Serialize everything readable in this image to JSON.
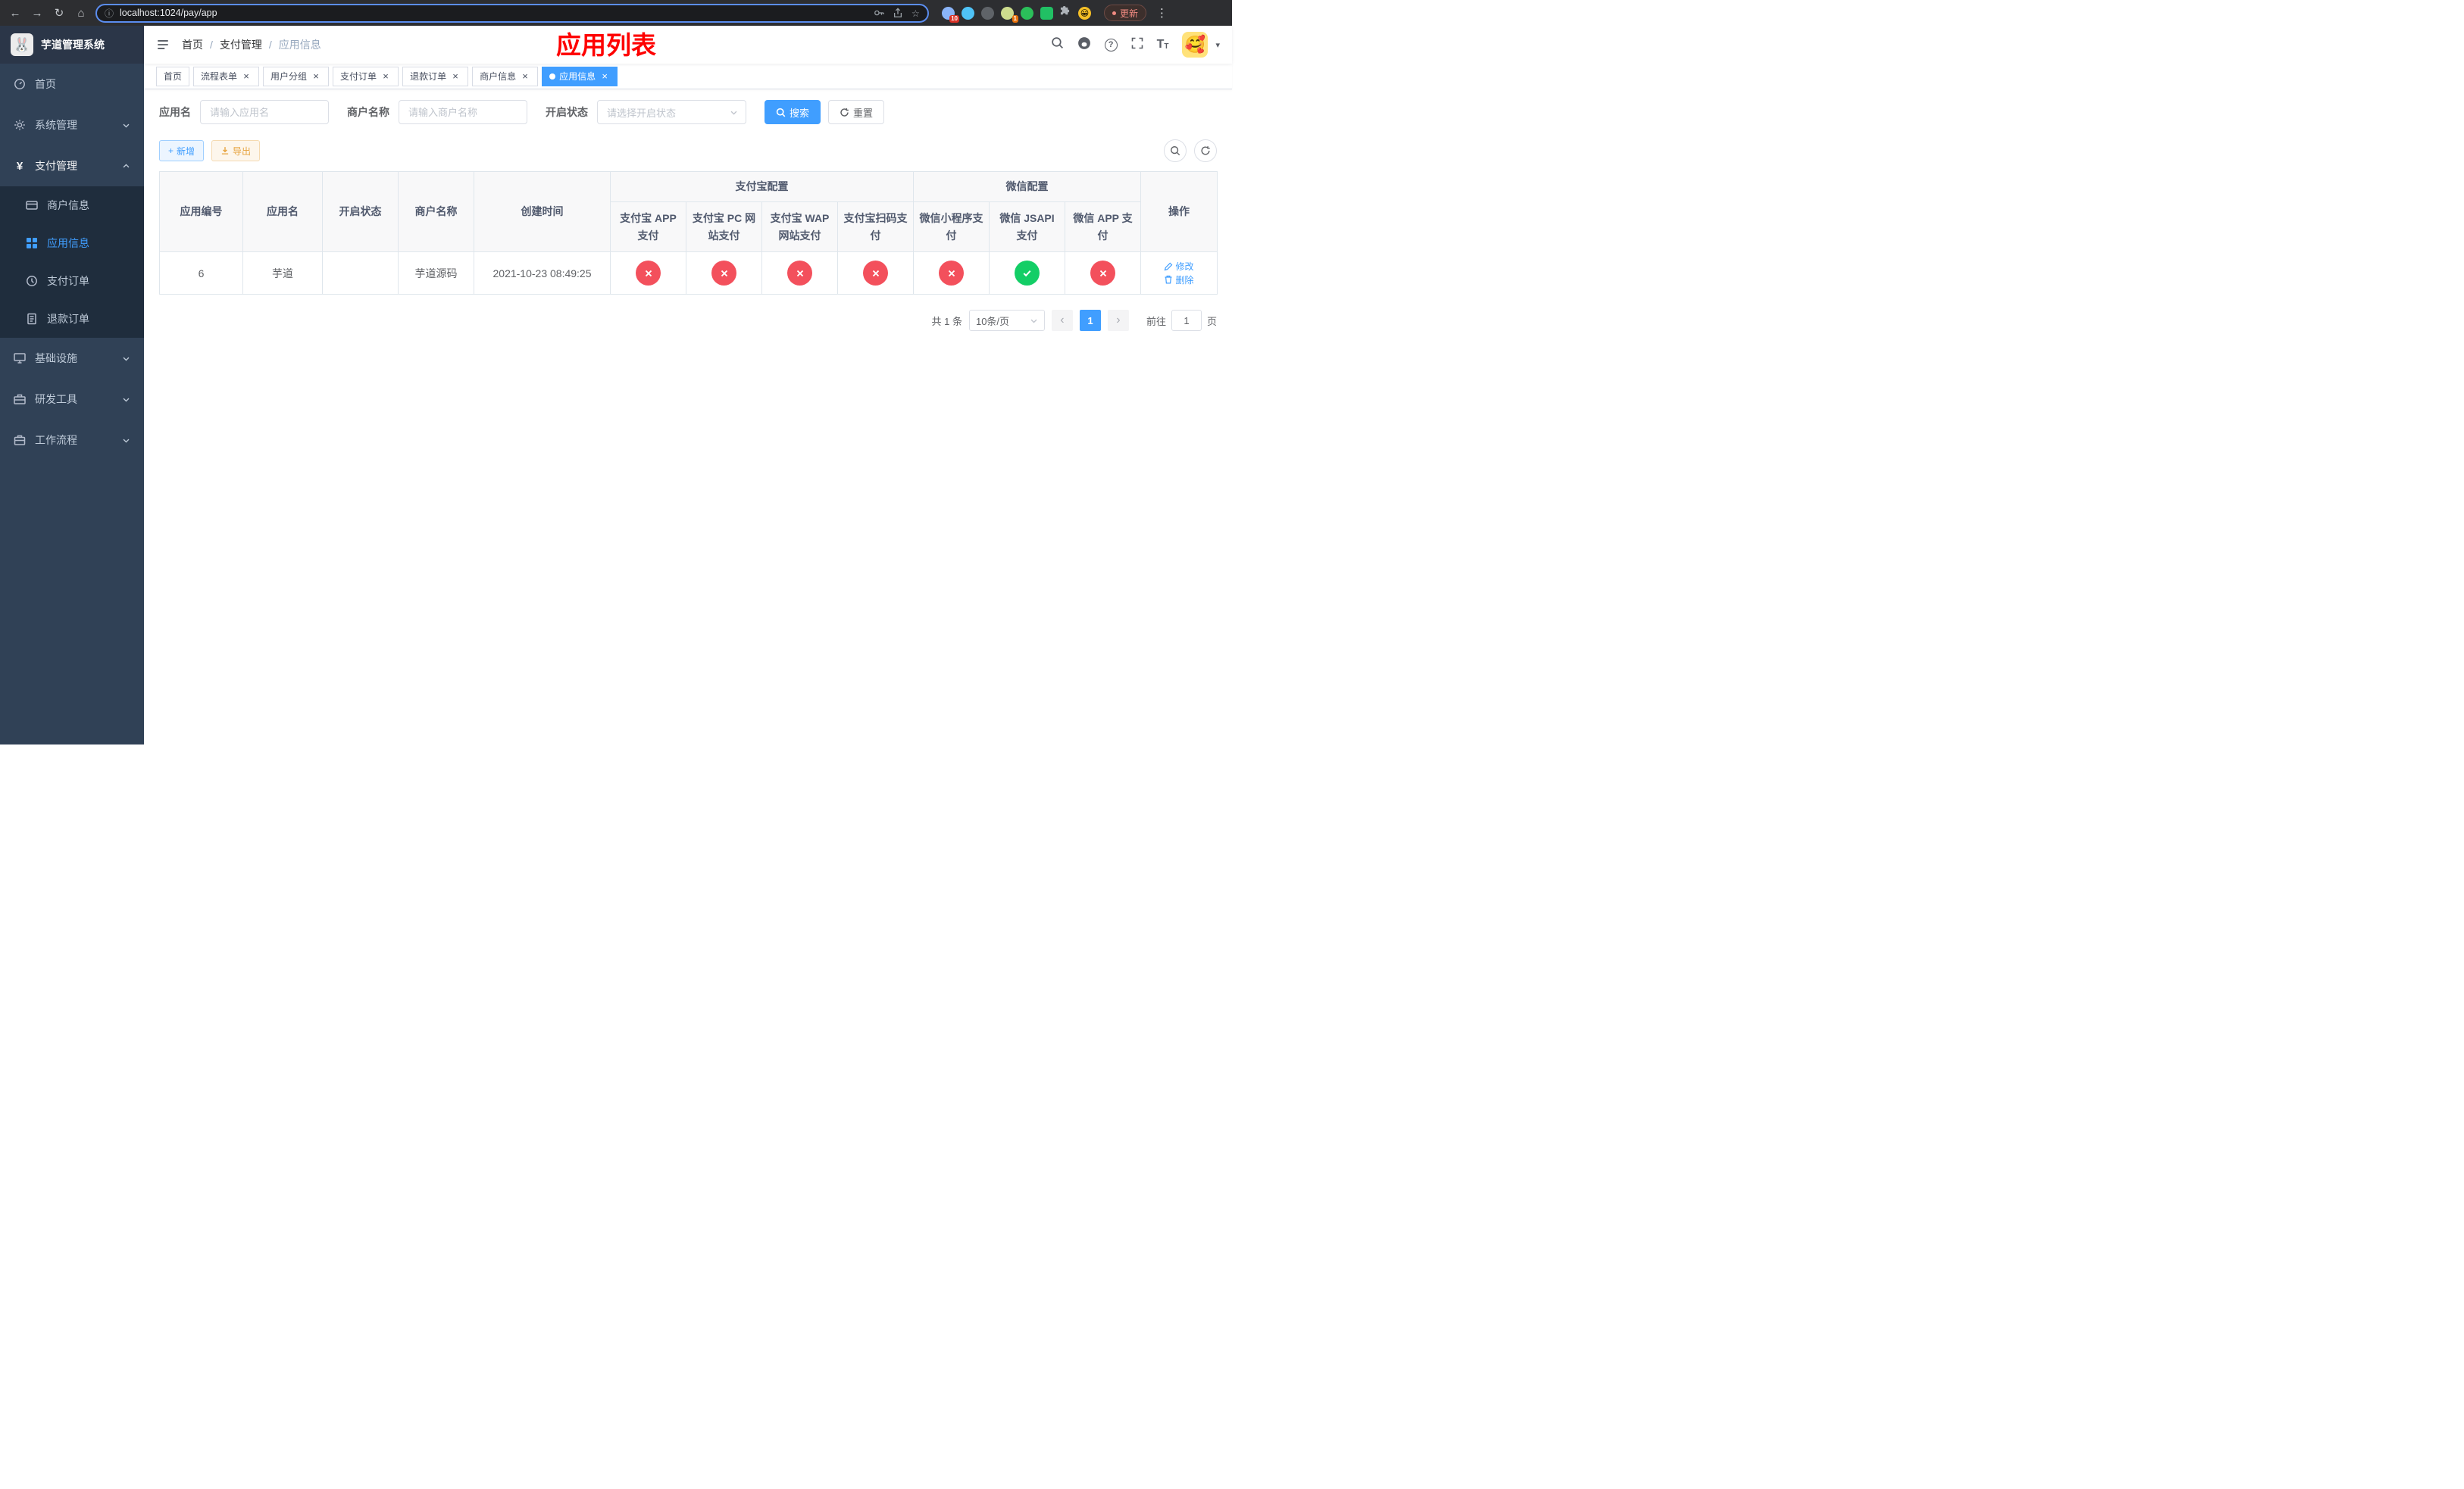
{
  "icons": {
    "back": "←",
    "forward": "→",
    "reload": "↻",
    "home": "⌂",
    "info": "ⓘ",
    "star": "☆",
    "menu_dots": "⋮",
    "caret_down": "▾",
    "close": "×",
    "plus": "+",
    "help": "?",
    "yen": "¥",
    "font_size": "T",
    "prev": "‹",
    "next": "›"
  },
  "browser": {
    "url": "localhost:1024/pay/app",
    "update_label": "更新",
    "ext_badge_count": "10",
    "translate_badge_count": "1",
    "profile_emoji": "😀"
  },
  "sidebar": {
    "logo_emoji": "🐰",
    "title": "芋道管理系统",
    "menu": {
      "home": "首页",
      "system": "系统管理",
      "payment": "支付管理",
      "merchant_info": "商户信息",
      "app_info": "应用信息",
      "pay_order": "支付订单",
      "refund_order": "退款订单",
      "infrastructure": "基础设施",
      "dev_tools": "研发工具",
      "workflow": "工作流程"
    }
  },
  "header": {
    "breadcrumb": [
      "首页",
      "支付管理",
      "应用信息"
    ],
    "separator": "/",
    "annotation": "应用列表",
    "avatar_emoji": "🥰"
  },
  "tabs": [
    {
      "label": "首页",
      "closable": false,
      "active": false
    },
    {
      "label": "流程表单",
      "closable": true,
      "active": false
    },
    {
      "label": "用户分组",
      "closable": true,
      "active": false
    },
    {
      "label": "支付订单",
      "closable": true,
      "active": false
    },
    {
      "label": "退款订单",
      "closable": true,
      "active": false
    },
    {
      "label": "商户信息",
      "closable": true,
      "active": false
    },
    {
      "label": "应用信息",
      "closable": true,
      "active": true
    }
  ],
  "filters": {
    "app_name_label": "应用名",
    "app_name_placeholder": "请输入应用名",
    "merchant_label": "商户名称",
    "merchant_placeholder": "请输入商户名称",
    "status_label": "开启状态",
    "status_placeholder": "请选择开启状态",
    "search_label": "搜索",
    "reset_label": "重置"
  },
  "toolbar": {
    "add_label": "新增",
    "export_label": "导出"
  },
  "table": {
    "headers": {
      "app_id": "应用编号",
      "app_name": "应用名",
      "status": "开启状态",
      "merchant_name": "商户名称",
      "create_time": "创建时间",
      "alipay_group": "支付宝配置",
      "wechat_group": "微信配置",
      "alipay_app": "支付宝 APP 支付",
      "alipay_pc": "支付宝 PC 网站支付",
      "alipay_wap": "支付宝 WAP 网站支付",
      "alipay_qr": "支付宝扫码支付",
      "wx_mini": "微信小程序支付",
      "wx_jsapi": "微信 JSAPI 支付",
      "wx_app": "微信 APP 支付",
      "actions": "操作"
    },
    "row": {
      "app_id": "6",
      "app_name": "芋道",
      "status_on": "true",
      "merchant_name": "芋道源码",
      "create_time": "2021-10-23 08:49:25",
      "configs": {
        "alipay_app": "disabled",
        "alipay_pc": "disabled",
        "alipay_wap": "disabled",
        "alipay_qr": "disabled",
        "wx_mini": "disabled",
        "wx_jsapi": "enabled",
        "wx_app": "disabled"
      },
      "edit_label": "修改",
      "delete_label": "删除"
    }
  },
  "pagination": {
    "total": "共 1 条",
    "page_size": "10条/页",
    "page": "1",
    "goto_label": "前往",
    "goto_value": "1",
    "page_unit": "页"
  },
  "colors": {
    "primary": "#409eff",
    "success": "#13ce66",
    "danger": "#f3505c",
    "warning": "#e6a23c",
    "annotation_red": "#fe0000",
    "sidebar_bg": "#304156",
    "submenu_bg": "#1f2d3d"
  }
}
